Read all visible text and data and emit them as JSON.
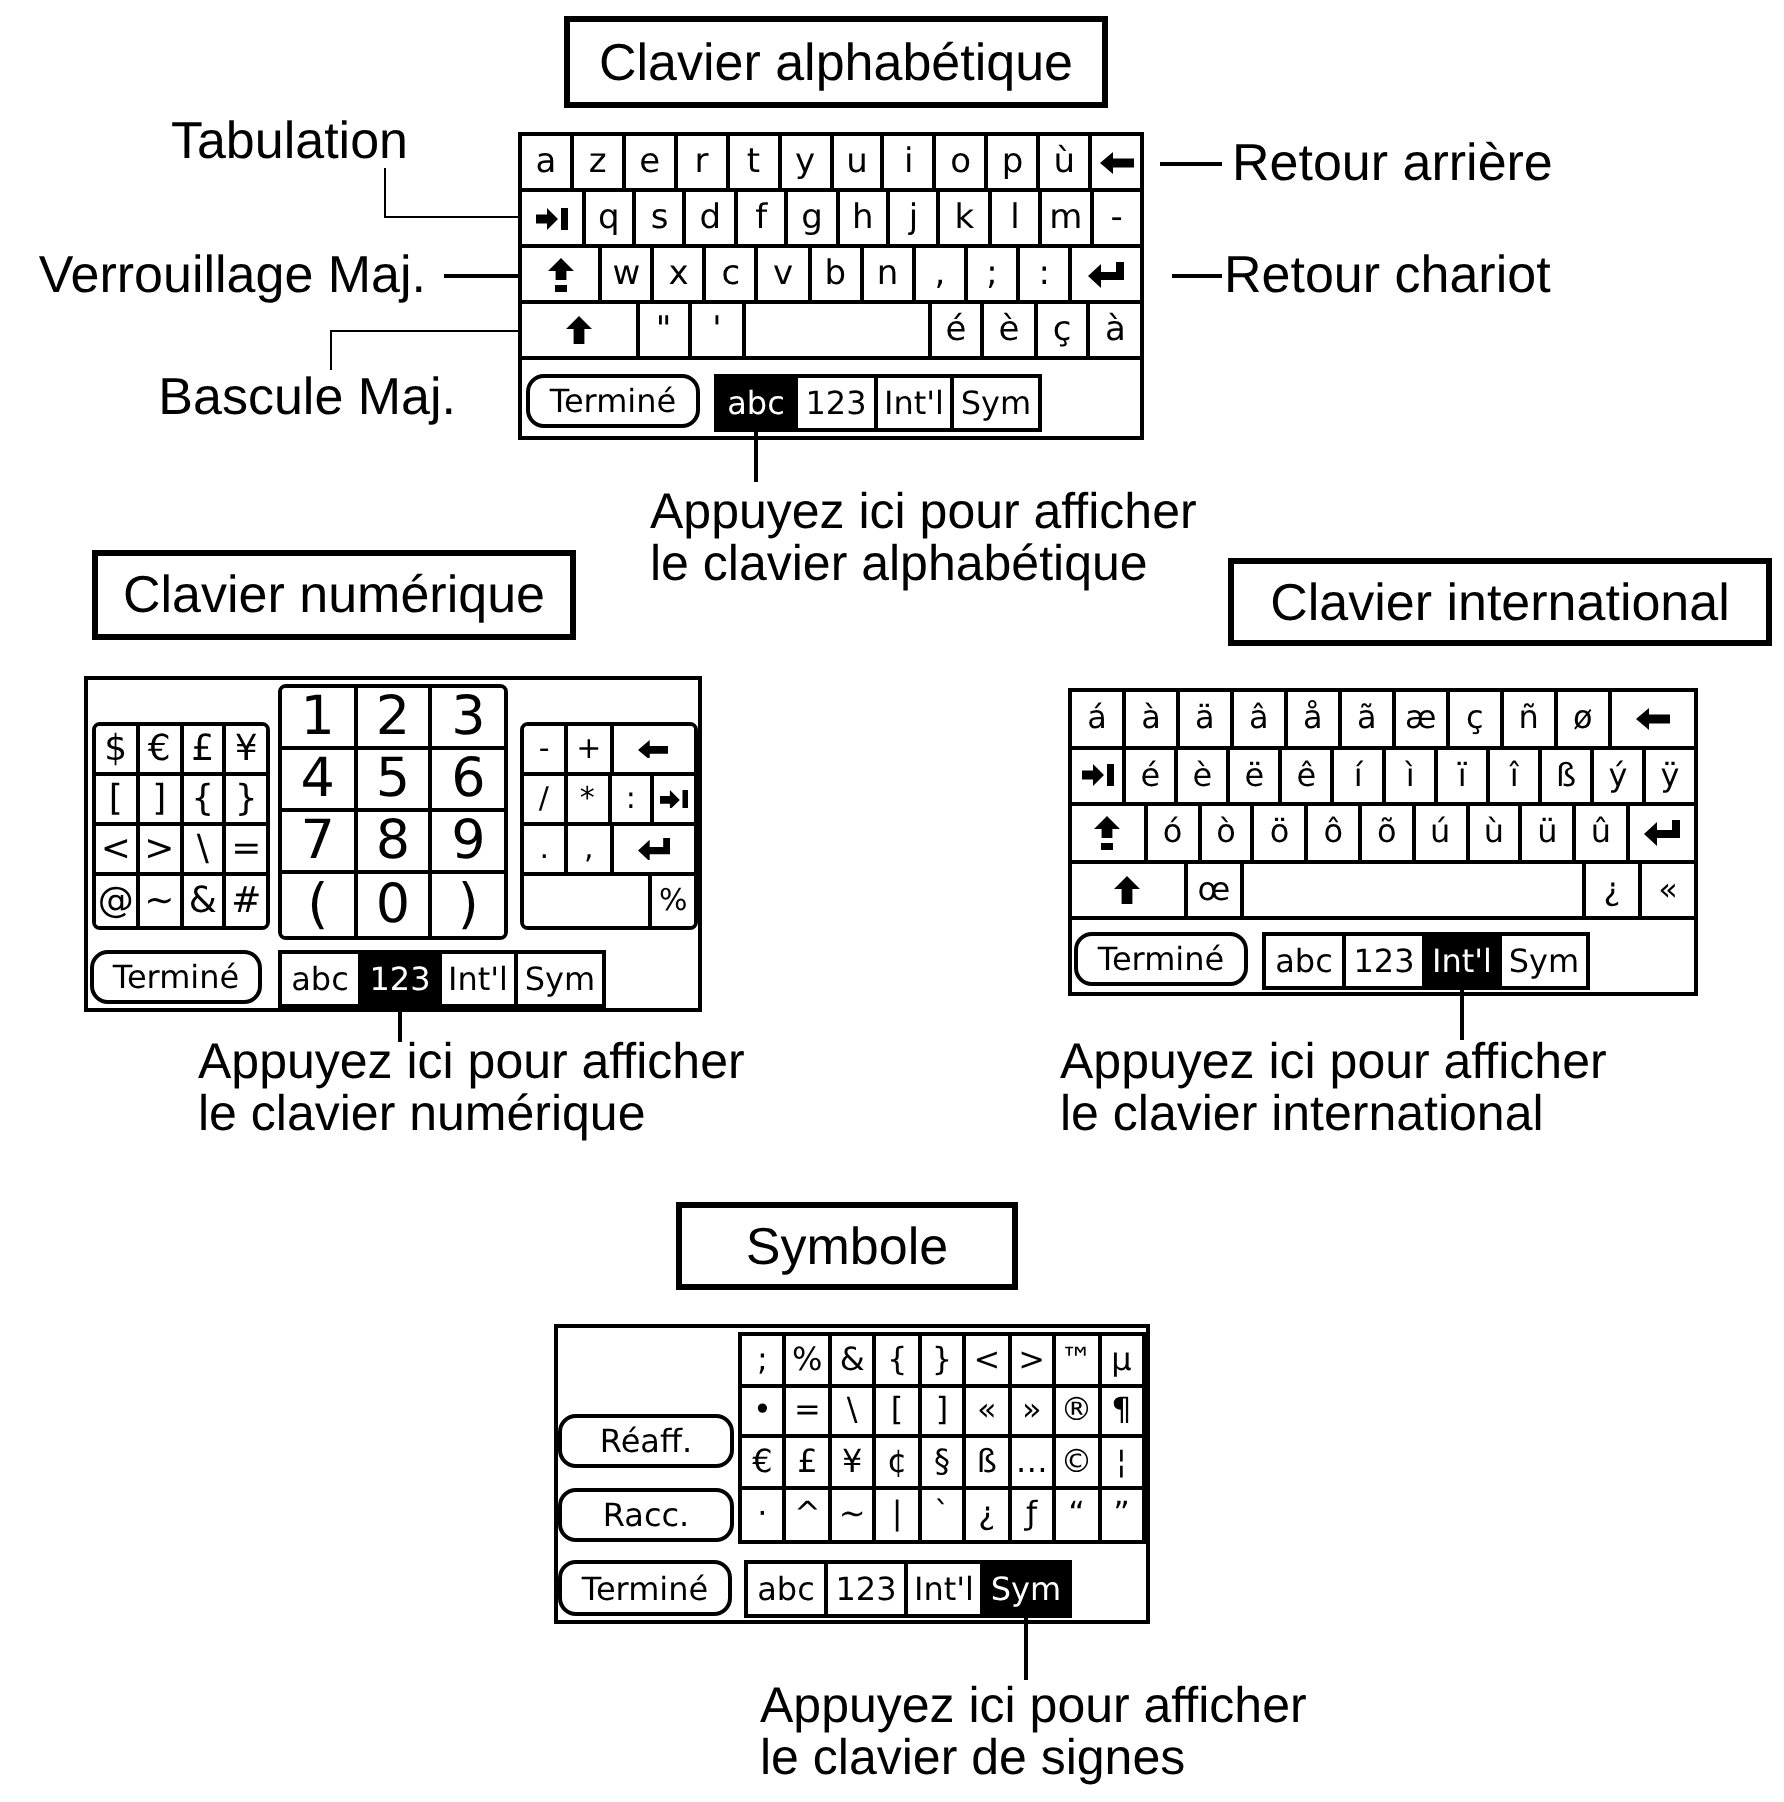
{
  "figures": [
    {
      "kind": "alphabetic",
      "title": "Clavier alphabétique",
      "left_callouts": [
        "Tabulation",
        "Verrouillage Maj.",
        "Bascule Maj."
      ],
      "right_callouts": [
        "Retour arrière",
        "Retour chariot"
      ],
      "keyboard": {
        "rows": [
          {
            "keys": [
              {
                "kind": "char",
                "label": "a"
              },
              {
                "kind": "char",
                "label": "z"
              },
              {
                "kind": "char",
                "label": "e"
              },
              {
                "kind": "char",
                "label": "r"
              },
              {
                "kind": "char",
                "label": "t"
              },
              {
                "kind": "char",
                "label": "y"
              },
              {
                "kind": "char",
                "label": "u"
              },
              {
                "kind": "char",
                "label": "i"
              },
              {
                "kind": "char",
                "label": "o"
              },
              {
                "kind": "char",
                "label": "p"
              },
              {
                "kind": "char",
                "label": "ù"
              },
              {
                "kind": "backspace"
              }
            ]
          },
          {
            "keys": [
              {
                "kind": "tab"
              },
              {
                "kind": "char",
                "label": "q"
              },
              {
                "kind": "char",
                "label": "s"
              },
              {
                "kind": "char",
                "label": "d"
              },
              {
                "kind": "char",
                "label": "f"
              },
              {
                "kind": "char",
                "label": "g"
              },
              {
                "kind": "char",
                "label": "h"
              },
              {
                "kind": "char",
                "label": "j"
              },
              {
                "kind": "char",
                "label": "k"
              },
              {
                "kind": "char",
                "label": "l"
              },
              {
                "kind": "char",
                "label": "m"
              },
              {
                "kind": "char",
                "label": "-"
              }
            ]
          },
          {
            "keys": [
              {
                "kind": "caps"
              },
              {
                "kind": "char",
                "label": "w"
              },
              {
                "kind": "char",
                "label": "x"
              },
              {
                "kind": "char",
                "label": "c"
              },
              {
                "kind": "char",
                "label": "v"
              },
              {
                "kind": "char",
                "label": "b"
              },
              {
                "kind": "char",
                "label": "n"
              },
              {
                "kind": "char",
                "label": ","
              },
              {
                "kind": "char",
                "label": ";"
              },
              {
                "kind": "char",
                "label": ":"
              },
              {
                "kind": "enter"
              }
            ]
          },
          {
            "keys": [
              {
                "kind": "shift"
              },
              {
                "kind": "char",
                "label": "\""
              },
              {
                "kind": "char",
                "label": "'"
              },
              {
                "kind": "space"
              },
              {
                "kind": "char",
                "label": "é"
              },
              {
                "kind": "char",
                "label": "è"
              },
              {
                "kind": "char",
                "label": "ç"
              },
              {
                "kind": "char",
                "label": "à"
              }
            ]
          }
        ],
        "buttons": [
          "Terminé"
        ],
        "mode_tabs": [
          {
            "label": "abc",
            "selected": true
          },
          {
            "label": "123",
            "selected": false
          },
          {
            "label": "Int'l",
            "selected": false
          },
          {
            "label": "Sym",
            "selected": false
          }
        ]
      },
      "caption": "Appuyez ici pour afficher\nle clavier alphabétique"
    },
    {
      "kind": "numeric",
      "title": "Clavier numérique",
      "keyboard": {
        "blocks": [
          {
            "rows": [
              {
                "keys": [
                  {
                    "kind": "char",
                    "label": "$"
                  },
                  {
                    "kind": "char",
                    "label": "€"
                  },
                  {
                    "kind": "char",
                    "label": "£"
                  },
                  {
                    "kind": "char",
                    "label": "¥"
                  }
                ]
              },
              {
                "keys": [
                  {
                    "kind": "char",
                    "label": "["
                  },
                  {
                    "kind": "char",
                    "label": "]"
                  },
                  {
                    "kind": "char",
                    "label": "{"
                  },
                  {
                    "kind": "char",
                    "label": "}"
                  }
                ]
              },
              {
                "keys": [
                  {
                    "kind": "char",
                    "label": "<"
                  },
                  {
                    "kind": "char",
                    "label": ">"
                  },
                  {
                    "kind": "char",
                    "label": "\\"
                  },
                  {
                    "kind": "char",
                    "label": "="
                  }
                ]
              },
              {
                "keys": [
                  {
                    "kind": "char",
                    "label": "@"
                  },
                  {
                    "kind": "char",
                    "label": "~"
                  },
                  {
                    "kind": "char",
                    "label": "&"
                  },
                  {
                    "kind": "char",
                    "label": "#"
                  }
                ]
              }
            ]
          },
          {
            "rows": [
              {
                "keys": [
                  {
                    "kind": "char",
                    "label": "1"
                  },
                  {
                    "kind": "char",
                    "label": "2"
                  },
                  {
                    "kind": "char",
                    "label": "3"
                  }
                ]
              },
              {
                "keys": [
                  {
                    "kind": "char",
                    "label": "4"
                  },
                  {
                    "kind": "char",
                    "label": "5"
                  },
                  {
                    "kind": "char",
                    "label": "6"
                  }
                ]
              },
              {
                "keys": [
                  {
                    "kind": "char",
                    "label": "7"
                  },
                  {
                    "kind": "char",
                    "label": "8"
                  },
                  {
                    "kind": "char",
                    "label": "9"
                  }
                ]
              },
              {
                "keys": [
                  {
                    "kind": "char",
                    "label": "("
                  },
                  {
                    "kind": "char",
                    "label": "0"
                  },
                  {
                    "kind": "char",
                    "label": ")"
                  }
                ]
              }
            ]
          },
          {
            "rows": [
              {
                "keys": [
                  {
                    "kind": "char",
                    "label": "-"
                  },
                  {
                    "kind": "char",
                    "label": "+"
                  },
                  {
                    "kind": "backspace"
                  }
                ]
              },
              {
                "keys": [
                  {
                    "kind": "char",
                    "label": "/"
                  },
                  {
                    "kind": "char",
                    "label": "*"
                  },
                  {
                    "kind": "char",
                    "label": ":"
                  },
                  {
                    "kind": "tab"
                  }
                ]
              },
              {
                "keys": [
                  {
                    "kind": "char",
                    "label": "."
                  },
                  {
                    "kind": "char",
                    "label": ","
                  },
                  {
                    "kind": "enter"
                  }
                ]
              },
              {
                "keys": [
                  {
                    "kind": "blank"
                  },
                  {
                    "kind": "char",
                    "label": "%"
                  }
                ]
              }
            ]
          }
        ],
        "buttons": [
          "Terminé"
        ],
        "mode_tabs": [
          {
            "label": "abc",
            "selected": false
          },
          {
            "label": "123",
            "selected": true
          },
          {
            "label": "Int'l",
            "selected": false
          },
          {
            "label": "Sym",
            "selected": false
          }
        ]
      },
      "caption": "Appuyez ici pour afficher\nle clavier numérique"
    },
    {
      "kind": "international",
      "title": "Clavier international",
      "keyboard": {
        "rows": [
          {
            "keys": [
              {
                "kind": "char",
                "label": "á"
              },
              {
                "kind": "char",
                "label": "à"
              },
              {
                "kind": "char",
                "label": "ä"
              },
              {
                "kind": "char",
                "label": "â"
              },
              {
                "kind": "char",
                "label": "å"
              },
              {
                "kind": "char",
                "label": "ã"
              },
              {
                "kind": "char",
                "label": "æ"
              },
              {
                "kind": "char",
                "label": "ç"
              },
              {
                "kind": "char",
                "label": "ñ"
              },
              {
                "kind": "char",
                "label": "ø"
              },
              {
                "kind": "backspace"
              }
            ]
          },
          {
            "keys": [
              {
                "kind": "tab"
              },
              {
                "kind": "char",
                "label": "é"
              },
              {
                "kind": "char",
                "label": "è"
              },
              {
                "kind": "char",
                "label": "ë"
              },
              {
                "kind": "char",
                "label": "ê"
              },
              {
                "kind": "char",
                "label": "í"
              },
              {
                "kind": "char",
                "label": "ì"
              },
              {
                "kind": "char",
                "label": "ï"
              },
              {
                "kind": "char",
                "label": "î"
              },
              {
                "kind": "char",
                "label": "ß"
              },
              {
                "kind": "char",
                "label": "ý"
              },
              {
                "kind": "char",
                "label": "ÿ"
              }
            ]
          },
          {
            "keys": [
              {
                "kind": "caps"
              },
              {
                "kind": "char",
                "label": "ó"
              },
              {
                "kind": "char",
                "label": "ò"
              },
              {
                "kind": "char",
                "label": "ö"
              },
              {
                "kind": "char",
                "label": "ô"
              },
              {
                "kind": "char",
                "label": "õ"
              },
              {
                "kind": "char",
                "label": "ú"
              },
              {
                "kind": "char",
                "label": "ù"
              },
              {
                "kind": "char",
                "label": "ü"
              },
              {
                "kind": "char",
                "label": "û"
              },
              {
                "kind": "enter"
              }
            ]
          },
          {
            "keys": [
              {
                "kind": "shift"
              },
              {
                "kind": "char",
                "label": "œ"
              },
              {
                "kind": "space"
              },
              {
                "kind": "char",
                "label": "¿"
              },
              {
                "kind": "char",
                "label": "«"
              }
            ]
          }
        ],
        "buttons": [
          "Terminé"
        ],
        "mode_tabs": [
          {
            "label": "abc",
            "selected": false
          },
          {
            "label": "123",
            "selected": false
          },
          {
            "label": "Int'l",
            "selected": true
          },
          {
            "label": "Sym",
            "selected": false
          }
        ]
      },
      "caption": "Appuyez ici pour afficher\nle clavier international"
    },
    {
      "kind": "symbol",
      "title": "Symbole",
      "keyboard": {
        "rows": [
          {
            "keys": [
              {
                "kind": "char",
                "label": ";"
              },
              {
                "kind": "char",
                "label": "%"
              },
              {
                "kind": "char",
                "label": "&"
              },
              {
                "kind": "char",
                "label": "{"
              },
              {
                "kind": "char",
                "label": "}"
              },
              {
                "kind": "char",
                "label": "<"
              },
              {
                "kind": "char",
                "label": ">"
              },
              {
                "kind": "char",
                "label": "™"
              },
              {
                "kind": "char",
                "label": "µ"
              }
            ]
          },
          {
            "keys": [
              {
                "kind": "char",
                "label": "•"
              },
              {
                "kind": "char",
                "label": "="
              },
              {
                "kind": "char",
                "label": "\\"
              },
              {
                "kind": "char",
                "label": "["
              },
              {
                "kind": "char",
                "label": "]"
              },
              {
                "kind": "char",
                "label": "«"
              },
              {
                "kind": "char",
                "label": "»"
              },
              {
                "kind": "char",
                "label": "®"
              },
              {
                "kind": "char",
                "label": "¶"
              }
            ]
          },
          {
            "keys": [
              {
                "kind": "char",
                "label": "€"
              },
              {
                "kind": "char",
                "label": "£"
              },
              {
                "kind": "char",
                "label": "¥"
              },
              {
                "kind": "char",
                "label": "¢"
              },
              {
                "kind": "char",
                "label": "§"
              },
              {
                "kind": "char",
                "label": "ß"
              },
              {
                "kind": "char",
                "label": "…"
              },
              {
                "kind": "char",
                "label": "©"
              },
              {
                "kind": "char",
                "label": "¦"
              }
            ]
          },
          {
            "keys": [
              {
                "kind": "char",
                "label": "·"
              },
              {
                "kind": "char",
                "label": "^"
              },
              {
                "kind": "char",
                "label": "~"
              },
              {
                "kind": "char",
                "label": "|"
              },
              {
                "kind": "char",
                "label": "`"
              },
              {
                "kind": "char",
                "label": "¿"
              },
              {
                "kind": "char",
                "label": "ƒ"
              },
              {
                "kind": "char",
                "label": "“"
              },
              {
                "kind": "char",
                "label": "”"
              }
            ]
          }
        ],
        "buttons": [
          "Réaff.",
          "Racc.",
          "Terminé"
        ],
        "mode_tabs": [
          {
            "label": "abc",
            "selected": false
          },
          {
            "label": "123",
            "selected": false
          },
          {
            "label": "Int'l",
            "selected": false
          },
          {
            "label": "Sym",
            "selected": true
          }
        ]
      },
      "caption": "Appuyez ici pour afficher\nle clavier de signes"
    }
  ]
}
